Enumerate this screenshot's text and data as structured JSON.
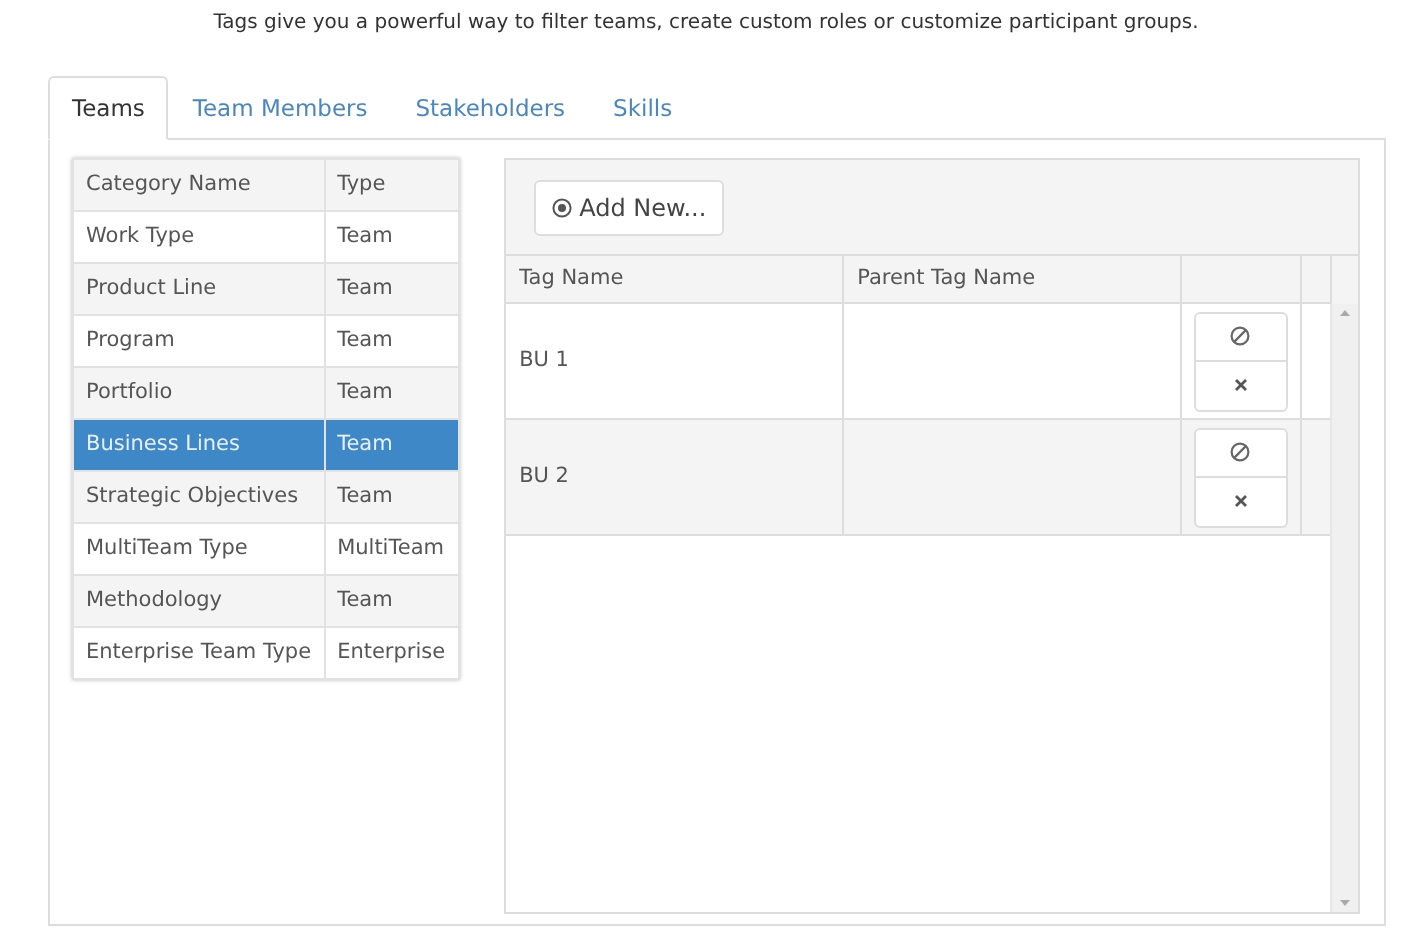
{
  "subtitle": "Tags give you a powerful way to filter teams, create custom roles or customize participant groups.",
  "tabs": [
    {
      "label": "Teams",
      "selected": true
    },
    {
      "label": "Team Members",
      "selected": false
    },
    {
      "label": "Stakeholders",
      "selected": false
    },
    {
      "label": "Skills",
      "selected": false
    }
  ],
  "categories": {
    "columns": [
      "Category Name",
      "Type"
    ],
    "rows": [
      {
        "name": "Work Type",
        "type": "Team",
        "selected": false
      },
      {
        "name": "Product Line",
        "type": "Team",
        "selected": false
      },
      {
        "name": "Program",
        "type": "Team",
        "selected": false
      },
      {
        "name": "Portfolio",
        "type": "Team",
        "selected": false
      },
      {
        "name": "Business Lines",
        "type": "Team",
        "selected": true
      },
      {
        "name": "Strategic Objectives",
        "type": "Team",
        "selected": false
      },
      {
        "name": "MultiTeam Type",
        "type": "MultiTeam",
        "selected": false
      },
      {
        "name": "Methodology",
        "type": "Team",
        "selected": false
      },
      {
        "name": "Enterprise Team Type",
        "type": "Enterprise",
        "selected": false
      }
    ]
  },
  "tags": {
    "add_button": "Add New...",
    "columns": [
      "Tag Name",
      "Parent Tag Name"
    ],
    "rows": [
      {
        "tag_name": "BU 1"
      },
      {
        "tag_name": "BU 2"
      }
    ]
  }
}
